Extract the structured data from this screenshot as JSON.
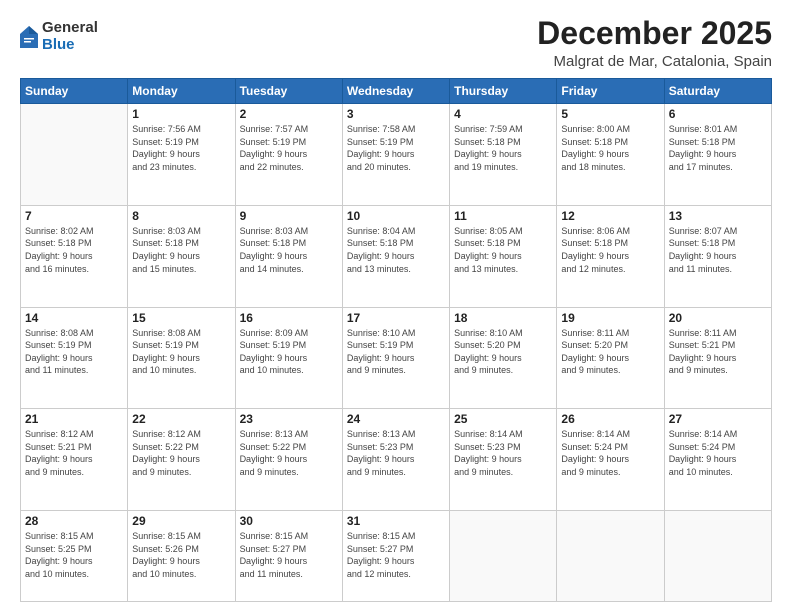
{
  "logo": {
    "general": "General",
    "blue": "Blue"
  },
  "header": {
    "month": "December 2025",
    "location": "Malgrat de Mar, Catalonia, Spain"
  },
  "weekdays": [
    "Sunday",
    "Monday",
    "Tuesday",
    "Wednesday",
    "Thursday",
    "Friday",
    "Saturday"
  ],
  "weeks": [
    [
      {
        "day": "",
        "info": ""
      },
      {
        "day": "1",
        "info": "Sunrise: 7:56 AM\nSunset: 5:19 PM\nDaylight: 9 hours\nand 23 minutes."
      },
      {
        "day": "2",
        "info": "Sunrise: 7:57 AM\nSunset: 5:19 PM\nDaylight: 9 hours\nand 22 minutes."
      },
      {
        "day": "3",
        "info": "Sunrise: 7:58 AM\nSunset: 5:19 PM\nDaylight: 9 hours\nand 20 minutes."
      },
      {
        "day": "4",
        "info": "Sunrise: 7:59 AM\nSunset: 5:18 PM\nDaylight: 9 hours\nand 19 minutes."
      },
      {
        "day": "5",
        "info": "Sunrise: 8:00 AM\nSunset: 5:18 PM\nDaylight: 9 hours\nand 18 minutes."
      },
      {
        "day": "6",
        "info": "Sunrise: 8:01 AM\nSunset: 5:18 PM\nDaylight: 9 hours\nand 17 minutes."
      }
    ],
    [
      {
        "day": "7",
        "info": "Sunrise: 8:02 AM\nSunset: 5:18 PM\nDaylight: 9 hours\nand 16 minutes."
      },
      {
        "day": "8",
        "info": "Sunrise: 8:03 AM\nSunset: 5:18 PM\nDaylight: 9 hours\nand 15 minutes."
      },
      {
        "day": "9",
        "info": "Sunrise: 8:03 AM\nSunset: 5:18 PM\nDaylight: 9 hours\nand 14 minutes."
      },
      {
        "day": "10",
        "info": "Sunrise: 8:04 AM\nSunset: 5:18 PM\nDaylight: 9 hours\nand 13 minutes."
      },
      {
        "day": "11",
        "info": "Sunrise: 8:05 AM\nSunset: 5:18 PM\nDaylight: 9 hours\nand 13 minutes."
      },
      {
        "day": "12",
        "info": "Sunrise: 8:06 AM\nSunset: 5:18 PM\nDaylight: 9 hours\nand 12 minutes."
      },
      {
        "day": "13",
        "info": "Sunrise: 8:07 AM\nSunset: 5:18 PM\nDaylight: 9 hours\nand 11 minutes."
      }
    ],
    [
      {
        "day": "14",
        "info": "Sunrise: 8:08 AM\nSunset: 5:19 PM\nDaylight: 9 hours\nand 11 minutes."
      },
      {
        "day": "15",
        "info": "Sunrise: 8:08 AM\nSunset: 5:19 PM\nDaylight: 9 hours\nand 10 minutes."
      },
      {
        "day": "16",
        "info": "Sunrise: 8:09 AM\nSunset: 5:19 PM\nDaylight: 9 hours\nand 10 minutes."
      },
      {
        "day": "17",
        "info": "Sunrise: 8:10 AM\nSunset: 5:19 PM\nDaylight: 9 hours\nand 9 minutes."
      },
      {
        "day": "18",
        "info": "Sunrise: 8:10 AM\nSunset: 5:20 PM\nDaylight: 9 hours\nand 9 minutes."
      },
      {
        "day": "19",
        "info": "Sunrise: 8:11 AM\nSunset: 5:20 PM\nDaylight: 9 hours\nand 9 minutes."
      },
      {
        "day": "20",
        "info": "Sunrise: 8:11 AM\nSunset: 5:21 PM\nDaylight: 9 hours\nand 9 minutes."
      }
    ],
    [
      {
        "day": "21",
        "info": "Sunrise: 8:12 AM\nSunset: 5:21 PM\nDaylight: 9 hours\nand 9 minutes."
      },
      {
        "day": "22",
        "info": "Sunrise: 8:12 AM\nSunset: 5:22 PM\nDaylight: 9 hours\nand 9 minutes."
      },
      {
        "day": "23",
        "info": "Sunrise: 8:13 AM\nSunset: 5:22 PM\nDaylight: 9 hours\nand 9 minutes."
      },
      {
        "day": "24",
        "info": "Sunrise: 8:13 AM\nSunset: 5:23 PM\nDaylight: 9 hours\nand 9 minutes."
      },
      {
        "day": "25",
        "info": "Sunrise: 8:14 AM\nSunset: 5:23 PM\nDaylight: 9 hours\nand 9 minutes."
      },
      {
        "day": "26",
        "info": "Sunrise: 8:14 AM\nSunset: 5:24 PM\nDaylight: 9 hours\nand 9 minutes."
      },
      {
        "day": "27",
        "info": "Sunrise: 8:14 AM\nSunset: 5:24 PM\nDaylight: 9 hours\nand 10 minutes."
      }
    ],
    [
      {
        "day": "28",
        "info": "Sunrise: 8:15 AM\nSunset: 5:25 PM\nDaylight: 9 hours\nand 10 minutes."
      },
      {
        "day": "29",
        "info": "Sunrise: 8:15 AM\nSunset: 5:26 PM\nDaylight: 9 hours\nand 10 minutes."
      },
      {
        "day": "30",
        "info": "Sunrise: 8:15 AM\nSunset: 5:27 PM\nDaylight: 9 hours\nand 11 minutes."
      },
      {
        "day": "31",
        "info": "Sunrise: 8:15 AM\nSunset: 5:27 PM\nDaylight: 9 hours\nand 12 minutes."
      },
      {
        "day": "",
        "info": ""
      },
      {
        "day": "",
        "info": ""
      },
      {
        "day": "",
        "info": ""
      }
    ]
  ]
}
